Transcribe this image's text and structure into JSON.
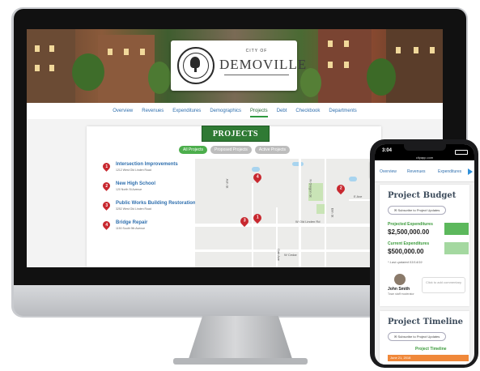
{
  "desktop": {
    "logo": {
      "city_of": "CITY OF",
      "city_name": "DEMOVILLE"
    },
    "nav": [
      "Overview",
      "Revenues",
      "Expenditures",
      "Demographics",
      "Projects",
      "Debt",
      "Checkbook",
      "Departments"
    ],
    "active_nav": "Projects",
    "section_title": "PROJECTS",
    "filters": [
      "All Projects",
      "Proposed Projects",
      "Active Projects"
    ],
    "projects": [
      {
        "num": "1",
        "name": "Intersection Improvements",
        "address": "1212 West Old Linden Road"
      },
      {
        "num": "2",
        "name": "New High School",
        "address": "120 North St Avenue"
      },
      {
        "num": "3",
        "name": "Public Works Building Restoration",
        "address": "3252 West Old Linden Road"
      },
      {
        "num": "4",
        "name": "Bridge Repair",
        "address": "1150 South 9th Avenue"
      }
    ],
    "map": {
      "zoom_in": "+",
      "zoom_out": "−",
      "labels": [
        "W Old Linden Rd",
        "N Oregon St",
        "Ash St",
        "Elm St",
        "Oak Ave",
        "E Ave",
        "W Cedar"
      ],
      "pins": [
        "4",
        "2",
        "3",
        "1"
      ]
    }
  },
  "phone": {
    "time": "3:04",
    "url": "cityapp.com",
    "nav": [
      "Overview",
      "Revenues",
      "Expenditures"
    ],
    "budget": {
      "title": "Project Budget",
      "subscribe": "Subscribe to Project Updates",
      "projected_label": "Projected Expenditures",
      "projected_value": "$2,500,000.00",
      "current_label": "Current Expenditures",
      "current_value": "$500,000.00",
      "updated": "* Last updated 03/14/19",
      "person_name": "John Smith",
      "person_role": "Town staff moderator",
      "comment_placeholder": "Click to add commentary"
    },
    "timeline": {
      "title": "Project Timeline",
      "subscribe": "Subscribe to Project Updates",
      "label": "Project Timeline",
      "first_bar": "June 21, 2018"
    }
  }
}
